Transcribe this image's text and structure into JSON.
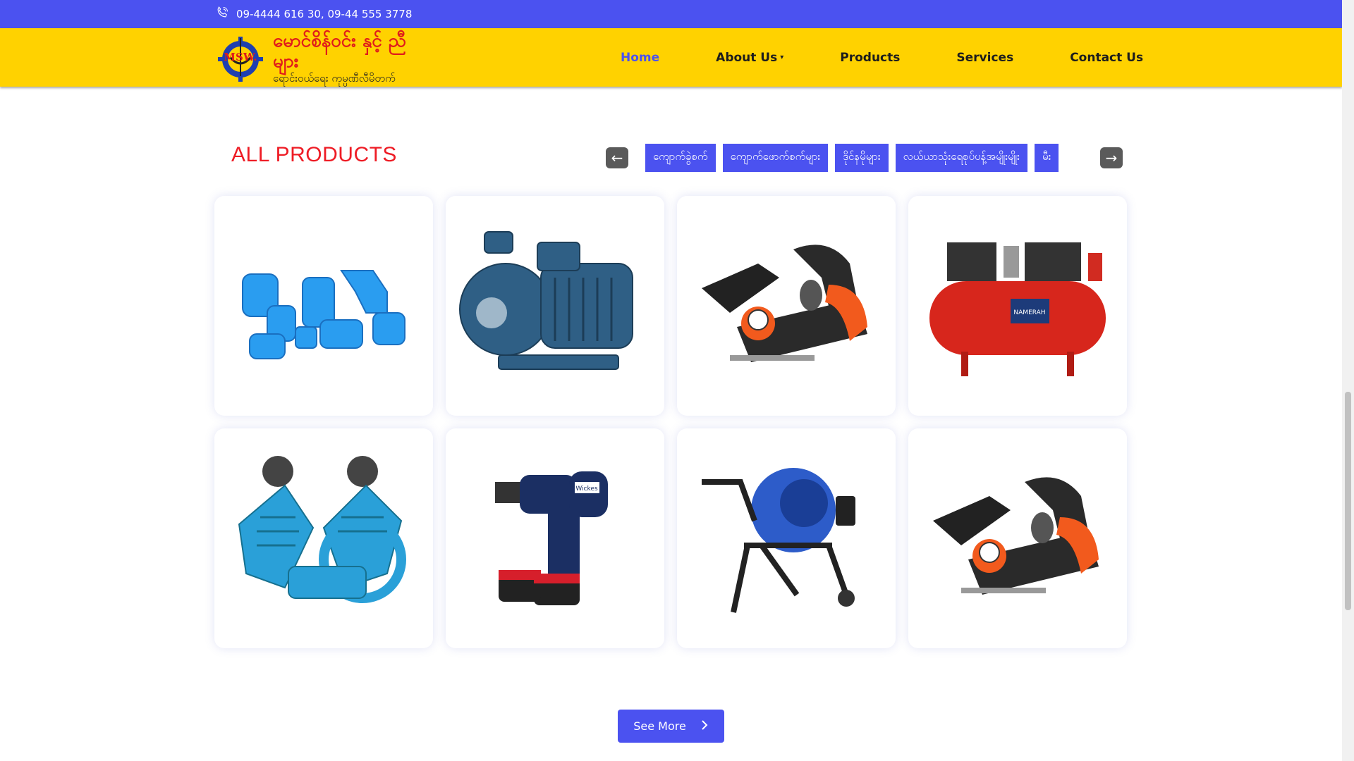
{
  "topbar": {
    "phone_icon": "phone-icon",
    "phone_text": "09-4444 616 30, 09-44 555 3778"
  },
  "logo": {
    "mark_text": "MSW",
    "title": "မောင်စိန်ဝင်း နှင့် ညီများ",
    "subtitle": "ရောင်းဝယ်ရေး ကုမ္ပဏီလီမိတက်"
  },
  "nav": {
    "items": [
      {
        "label": "Home",
        "active": true
      },
      {
        "label": "About Us",
        "dropdown": true
      },
      {
        "label": "Products"
      },
      {
        "label": "Services"
      },
      {
        "label": "Contact Us"
      }
    ]
  },
  "products_section": {
    "title": "ALL PRODUCTS",
    "prev_icon": "arrow-left-icon",
    "next_icon": "arrow-right-icon",
    "categories": [
      "ကျောက်ခွဲစက်",
      "ကျောက်ဖောက်စက်များ",
      "ဒိုင်နမိုများ",
      "လယ်ယာသုံးရေစုပ်ပန့်အမျိုးမျိုး",
      "မီး"
    ],
    "products": [
      {
        "icon": "pvc-fittings-image"
      },
      {
        "icon": "centrifugal-pump-image"
      },
      {
        "icon": "electric-planer-image"
      },
      {
        "icon": "air-compressor-tank-image"
      },
      {
        "icon": "compressor-head-image"
      },
      {
        "icon": "cordless-drill-image"
      },
      {
        "icon": "cement-mixer-image"
      },
      {
        "icon": "electric-planer-image"
      }
    ],
    "see_more": "See More",
    "see_more_icon": "chevron-right-icon"
  },
  "colors": {
    "topbar": "#4b52f0",
    "navbar": "#ffd200",
    "accent": "#4b52f0",
    "title_red": "#ee1c25"
  }
}
